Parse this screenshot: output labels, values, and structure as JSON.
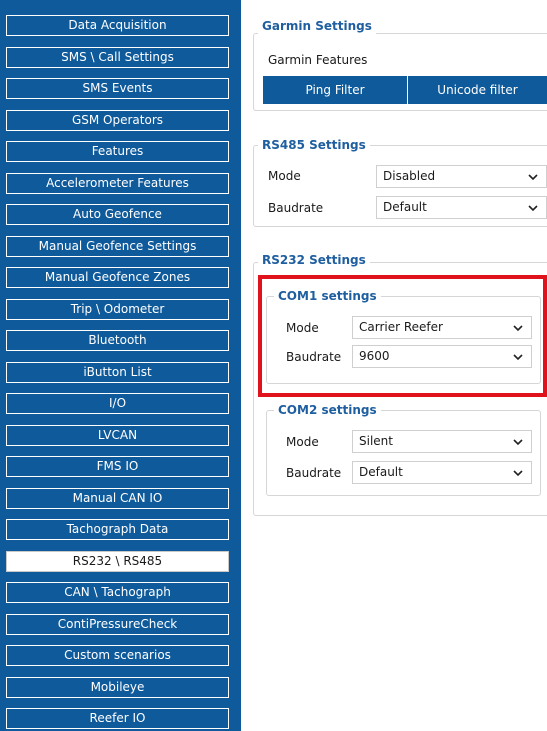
{
  "sidebar": {
    "items": [
      {
        "label": "Data Acquisition",
        "active": false
      },
      {
        "label": "SMS \\ Call Settings",
        "active": false
      },
      {
        "label": "SMS Events",
        "active": false
      },
      {
        "label": "GSM Operators",
        "active": false
      },
      {
        "label": "Features",
        "active": false
      },
      {
        "label": "Accelerometer Features",
        "active": false
      },
      {
        "label": "Auto Geofence",
        "active": false
      },
      {
        "label": "Manual Geofence Settings",
        "active": false
      },
      {
        "label": "Manual Geofence Zones",
        "active": false
      },
      {
        "label": "Trip \\ Odometer",
        "active": false
      },
      {
        "label": "Bluetooth",
        "active": false
      },
      {
        "label": "iButton List",
        "active": false
      },
      {
        "label": "I/O",
        "active": false
      },
      {
        "label": "LVCAN",
        "active": false
      },
      {
        "label": "FMS IO",
        "active": false
      },
      {
        "label": "Manual CAN IO",
        "active": false
      },
      {
        "label": "Tachograph Data",
        "active": false
      },
      {
        "label": "RS232 \\ RS485",
        "active": true
      },
      {
        "label": "CAN \\ Tachograph",
        "active": false
      },
      {
        "label": "ContiPressureCheck",
        "active": false
      },
      {
        "label": "Custom scenarios",
        "active": false
      },
      {
        "label": "Mobileye",
        "active": false
      },
      {
        "label": "Reefer IO",
        "active": false
      }
    ]
  },
  "garmin": {
    "title": "Garmin Settings",
    "features_label": "Garmin Features",
    "ping_filter": "Ping Filter",
    "unicode_filter": "Unicode filter"
  },
  "rs485": {
    "title": "RS485 Settings",
    "mode_label": "Mode",
    "mode_value": "Disabled",
    "baudrate_label": "Baudrate",
    "baudrate_value": "Default"
  },
  "rs232": {
    "title": "RS232 Settings",
    "com1": {
      "title": "COM1 settings",
      "mode_label": "Mode",
      "mode_value": "Carrier Reefer",
      "baudrate_label": "Baudrate",
      "baudrate_value": "9600"
    },
    "com2": {
      "title": "COM2 settings",
      "mode_label": "Mode",
      "mode_value": "Silent",
      "baudrate_label": "Baudrate",
      "baudrate_value": "Default"
    }
  },
  "colors": {
    "sidebar_bg": "#0f5a9b",
    "accent": "#1f5fa0",
    "highlight": "#e0121c"
  }
}
